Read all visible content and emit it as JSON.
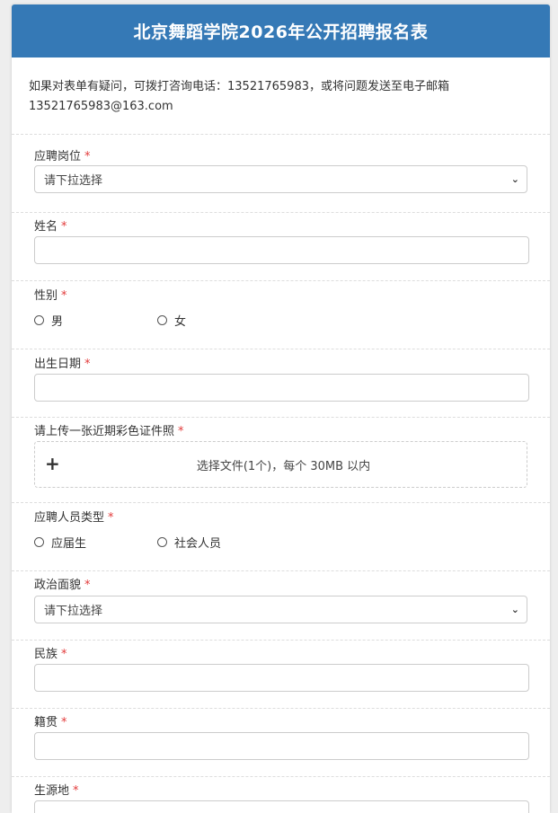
{
  "form": {
    "title": "北京舞蹈学院2026年公开招聘报名表",
    "intro_line1": "如果对表单有疑问，可拨打咨询电话：13521765983，或将问题发送至电子邮箱",
    "intro_line2": "13521765983@163.com",
    "required_mark": "*"
  },
  "fields": {
    "position": {
      "label": "应聘岗位",
      "placeholder": "请下拉选择"
    },
    "name": {
      "label": "姓名"
    },
    "gender": {
      "label": "性别",
      "options": [
        "男",
        "女"
      ]
    },
    "birthdate": {
      "label": "出生日期"
    },
    "photo": {
      "label": "请上传一张近期彩色证件照",
      "upload_text": "选择文件(1个)，每个 30MB 以内"
    },
    "applicant_type": {
      "label": "应聘人员类型",
      "options": [
        "应届生",
        "社会人员"
      ]
    },
    "political": {
      "label": "政治面貌",
      "placeholder": "请下拉选择"
    },
    "ethnicity": {
      "label": "民族"
    },
    "native_place": {
      "label": "籍贯"
    },
    "origin": {
      "label": "生源地"
    }
  },
  "colors": {
    "header": "#3579b6",
    "required": "#e23b3b"
  }
}
